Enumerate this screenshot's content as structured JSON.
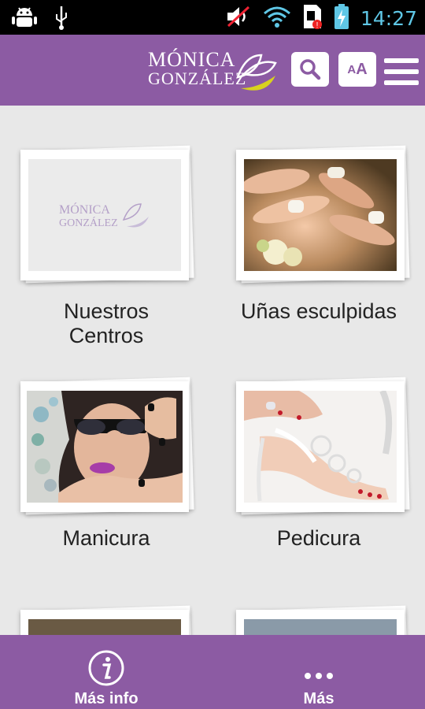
{
  "status_bar": {
    "time": "14:27",
    "icons": [
      "android-debug-icon",
      "usb-icon",
      "volume-muted-icon",
      "wifi-icon",
      "sim-alert-icon",
      "battery-charging-icon"
    ]
  },
  "header": {
    "logo_line1": "MÓNICA",
    "logo_line2": "GONZÁLEZ",
    "font_button_small": "A",
    "font_button_large": "A"
  },
  "tiles": [
    {
      "label_line1": "Nuestros",
      "label_line2": "Centros",
      "image": "logo-placeholder"
    },
    {
      "label_line1": "Uñas esculpidas",
      "label_line2": "",
      "image": "sculpted-nails-photo"
    },
    {
      "label_line1": "Manicura",
      "label_line2": "",
      "image": "manicure-photo"
    },
    {
      "label_line1": "Pedicura",
      "label_line2": "",
      "image": "pedicure-photo"
    }
  ],
  "bottom_bar": {
    "info_label": "Más info",
    "more_label": "Más"
  },
  "colors": {
    "brand_purple": "#8c5ba3",
    "status_blue": "#5fc7e6",
    "logo_yellow": "#d8d21e"
  }
}
